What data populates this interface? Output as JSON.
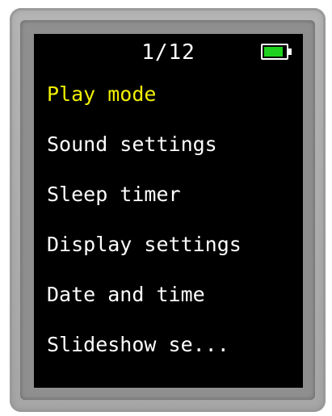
{
  "status": {
    "page_indicator": "1/12",
    "battery_icon": "battery-full-icon",
    "battery_level": 0.9
  },
  "menu": {
    "selected_index": 0,
    "items": [
      {
        "label": "Play mode"
      },
      {
        "label": "Sound settings"
      },
      {
        "label": "Sleep timer"
      },
      {
        "label": "Display settings"
      },
      {
        "label": "Date and time"
      },
      {
        "label": "Slideshow se..."
      }
    ]
  },
  "colors": {
    "screen_background": "#000000",
    "text": "#ffffff",
    "selected_text": "#f0f000",
    "battery_fill": "#1fd21f",
    "device_body": "#a8a8a8"
  }
}
